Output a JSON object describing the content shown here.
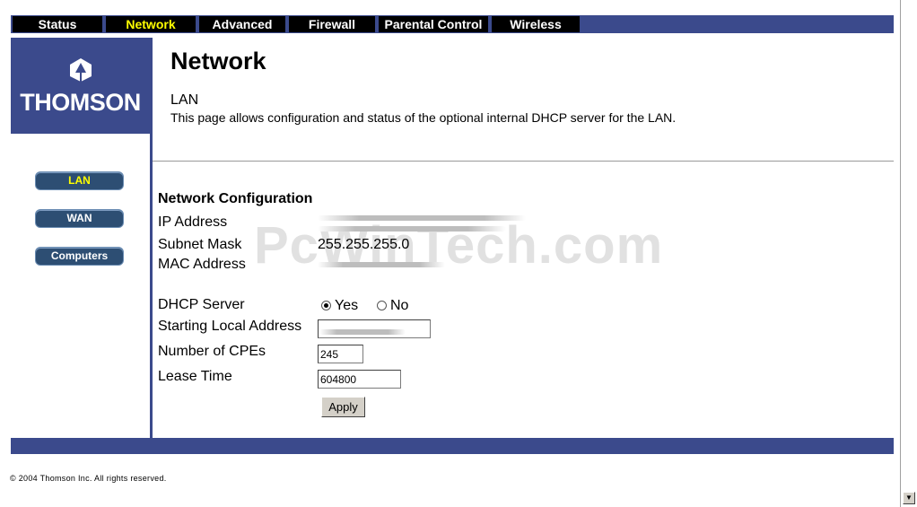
{
  "nav": {
    "tabs": [
      {
        "label": "Status"
      },
      {
        "label": "Network",
        "active": true
      },
      {
        "label": "Advanced"
      },
      {
        "label": "Firewall"
      },
      {
        "label": "Parental Control"
      },
      {
        "label": "Wireless"
      }
    ]
  },
  "brand": {
    "name": "THOMSON",
    "icon": "thomson-logo-icon"
  },
  "sidebar": {
    "items": [
      {
        "label": "LAN",
        "active": true
      },
      {
        "label": "WAN"
      },
      {
        "label": "Computers"
      }
    ]
  },
  "header": {
    "title": "Network",
    "section": "LAN",
    "description": "This page allows configuration and status of the optional internal DHCP server for the LAN."
  },
  "config": {
    "heading": "Network Configuration",
    "ip_label": "IP Address",
    "subnet_label": "Subnet Mask",
    "subnet_value": "255.255.255.0",
    "mac_label": "MAC Address",
    "dhcp_label": "DHCP Server",
    "dhcp_yes": "Yes",
    "dhcp_no": "No",
    "dhcp_selected": "Yes",
    "start_label": "Starting Local Address",
    "cpes_label": "Number of CPEs",
    "cpes_value": "245",
    "lease_label": "Lease Time",
    "lease_value": "604800",
    "apply_label": "Apply"
  },
  "watermark": "PcWinTech.com",
  "footer": {
    "copyright": "© 2004 Thomson Inc.  All rights reserved."
  },
  "colors": {
    "bar": "#3b4a8c",
    "active_text": "#ffff00",
    "button": "#2d4e73"
  }
}
